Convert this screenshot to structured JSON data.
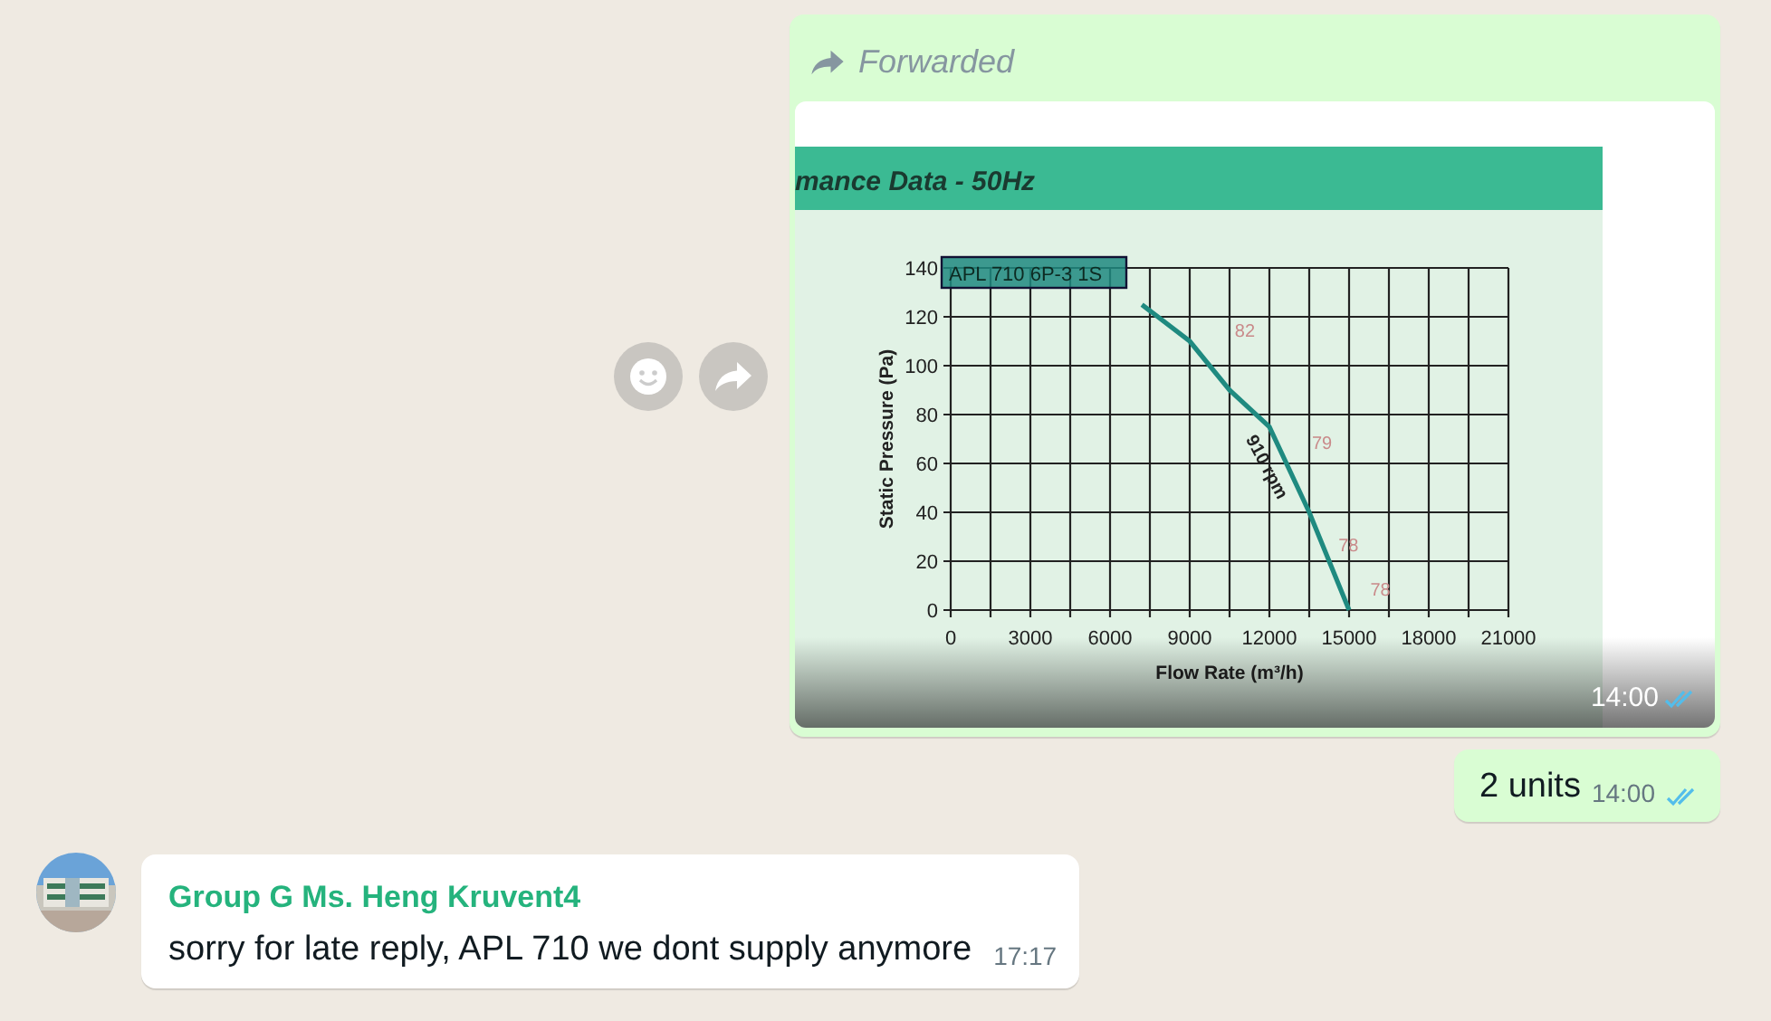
{
  "forwarded_message": {
    "label": "Forwarded",
    "time": "14:00",
    "read": true,
    "document": {
      "header": "mance Data -  50Hz",
      "chart_data": {
        "type": "line",
        "xlabel": "Flow Rate (m³/h)",
        "ylabel": "Static Pressure (Pa)",
        "x": [
          7200,
          9000,
          10500,
          12000,
          13500,
          15000
        ],
        "series": [
          {
            "name": "APL 710 6P-3 1S",
            "color": "#1f8a80",
            "values": [
              125,
              110,
              90,
              75,
              40,
              0
            ]
          }
        ],
        "xlim": [
          0,
          21000
        ],
        "ylim": [
          0,
          140
        ],
        "xticks": [
          0,
          3000,
          6000,
          9000,
          12000,
          15000,
          18000,
          21000
        ],
        "yticks": [
          0,
          20,
          40,
          60,
          80,
          100,
          120,
          140
        ],
        "grid": true,
        "annotations": [
          "82",
          "79",
          "78",
          "78",
          "910 rpm"
        ]
      }
    }
  },
  "outgoing_message": {
    "text": "2 units",
    "time": "14:00",
    "read": true
  },
  "incoming_message": {
    "sender": "Group G Ms. Heng Kruvent4",
    "text": "sorry for late reply, APL 710 we dont supply anymore",
    "time": "17:17"
  }
}
